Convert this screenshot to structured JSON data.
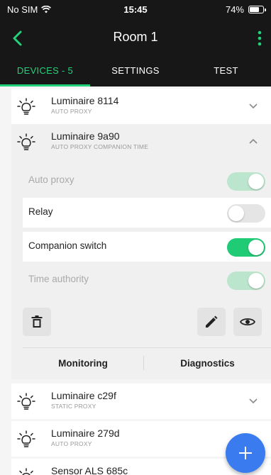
{
  "status_bar": {
    "carrier": "No SIM",
    "time": "15:45",
    "battery": "74%",
    "battery_level": 0.74
  },
  "app_bar": {
    "title": "Room 1",
    "back_icon": "chevron-left-icon",
    "menu_icon": "more-vert-icon"
  },
  "tabs": [
    {
      "label": "DEVICES - 5",
      "active": true
    },
    {
      "label": "SETTINGS",
      "active": false
    },
    {
      "label": "TEST",
      "active": false
    }
  ],
  "devices": [
    {
      "name": "Luminaire 8114",
      "sub": "AUTO PROXY",
      "icon": "bulb-icon",
      "expanded": false
    },
    {
      "name": "Luminaire 9a90",
      "sub": "AUTO PROXY  COMPANION  TIME",
      "icon": "bulb-icon",
      "expanded": true
    },
    {
      "name": "Luminaire c29f",
      "sub": "STATIC PROXY",
      "icon": "bulb-icon",
      "expanded": false
    },
    {
      "name": "Luminaire 279d",
      "sub": "AUTO PROXY",
      "icon": "bulb-icon",
      "expanded": false
    },
    {
      "name": "Sensor ALS 685c",
      "sub": "",
      "icon": "bulb-icon",
      "expanded": false
    }
  ],
  "settings": [
    {
      "label": "Auto proxy",
      "state": "on",
      "disabled": true
    },
    {
      "label": "Relay",
      "state": "off",
      "disabled": false
    },
    {
      "label": "Companion switch",
      "state": "on",
      "disabled": false
    },
    {
      "label": "Time authority",
      "state": "on",
      "disabled": true
    }
  ],
  "actions": {
    "delete_icon": "trash-icon",
    "edit_icon": "pencil-icon",
    "view_icon": "eye-icon"
  },
  "bottom_tabs": {
    "left": "Monitoring",
    "right": "Diagnostics"
  },
  "fab": {
    "icon": "plus-icon"
  },
  "colors": {
    "accent": "#22d27a",
    "toggle_on": "#1fcb75",
    "fab": "#3a7cf0",
    "header_bg": "#171717"
  }
}
